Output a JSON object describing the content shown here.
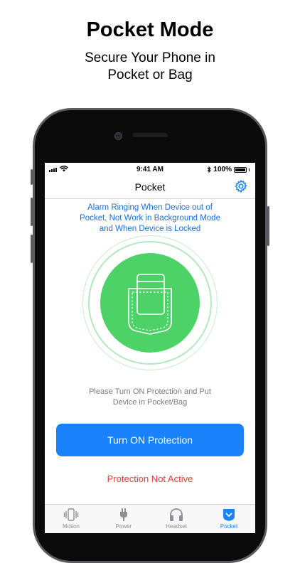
{
  "promo": {
    "headline": "Pocket Mode",
    "subhead_line1": "Secure Your Phone in",
    "subhead_line2": "Pocket or Bag"
  },
  "status_bar": {
    "time": "9:41 AM",
    "battery": "100%"
  },
  "nav": {
    "title": "Pocket"
  },
  "notice": {
    "line1": "Alarm Ringing When Device out of",
    "line2": "Pocket, Not Work in Background Mode",
    "line3": "and When Device is Locked"
  },
  "instruction": {
    "line1": "Please Turn ON Protection and Put",
    "line2": "Device in Pocket/Bag"
  },
  "button": {
    "label": "Turn ON Protection"
  },
  "state": {
    "label": "Protection Not Active"
  },
  "tabs": [
    {
      "label": "Motion",
      "icon": "vibrate-phone-icon"
    },
    {
      "label": "Power",
      "icon": "plug-icon"
    },
    {
      "label": "Headset",
      "icon": "headphones-icon"
    },
    {
      "label": "Pocket",
      "icon": "pocket-icon",
      "active": true
    }
  ],
  "colors": {
    "accent": "#1a82fb",
    "success_green": "#4dd267",
    "notice_blue": "#1a6fd8",
    "inactive_red": "#ea3b34"
  }
}
